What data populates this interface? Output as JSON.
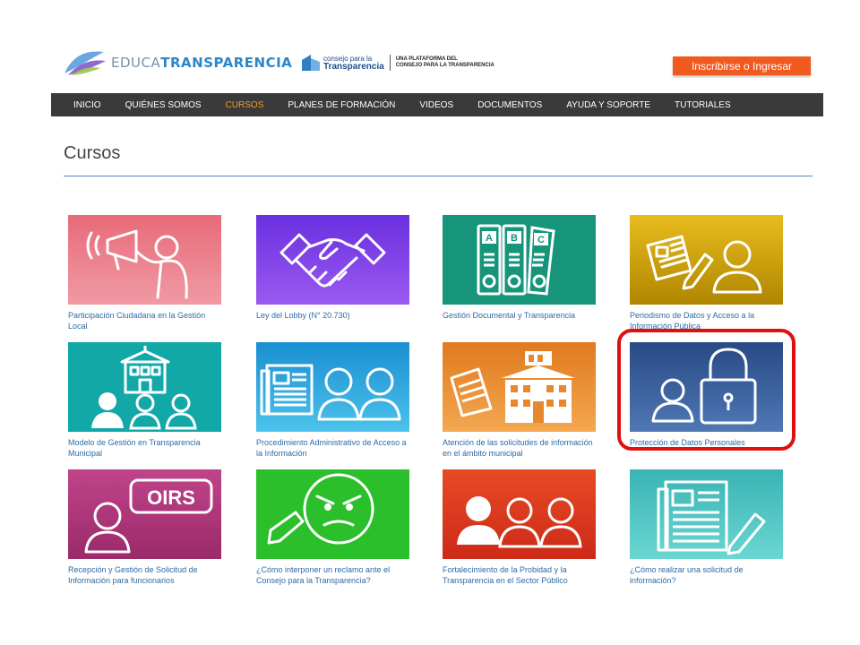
{
  "header": {
    "logo_part1": "EDUCA",
    "logo_part2": "TRANSPARENCIA",
    "cplt_small": "consejo para la",
    "cplt_big": "Transparencia",
    "cplt_tag_line1": "UNA PLATAFORMA DEL",
    "cplt_tag_line2": "CONSEJO PARA LA TRANSPARENCIA",
    "cta_label": "Inscribirse o Ingresar"
  },
  "nav": {
    "items": [
      "INICIO",
      "QUIÉNES SOMOS",
      "CURSOS",
      "PLANES DE FORMACIÓN",
      "VIDEOS",
      "DOCUMENTOS",
      "AYUDA Y SOPORTE",
      "TUTORIALES"
    ],
    "active": "CURSOS"
  },
  "page": {
    "title": "Cursos"
  },
  "courses": [
    {
      "title": "Participación Ciudadana en la Gestión Local",
      "color": "#e8707e",
      "icon": "megaphone-person-icon"
    },
    {
      "title": "Ley del Lobby (N° 20.730)",
      "color": "#7b3fe0",
      "icon": "handshake-icon"
    },
    {
      "title": "Gestión Documental y Transparencia",
      "color": "#16957a",
      "icon": "binders-icon"
    },
    {
      "title": "Periodismo de Datos y Acceso a la Información Pública",
      "color": "#d9a800",
      "icon": "newspaper-person-icon"
    },
    {
      "title": "Modelo de Gestión en Transparencia Municipal",
      "color": "#13a8a8",
      "icon": "municipality-people-icon"
    },
    {
      "title": "Procedimiento Administrativo de Acceso a la Información",
      "color": "#1e9fd8",
      "icon": "document-people-icon"
    },
    {
      "title": "Atención de las solicitudes de información en el ámbito municipal",
      "color": "#ec8a2e",
      "icon": "newspaper-building-icon"
    },
    {
      "title": "Protección de Datos Personales",
      "color": "#2f5590",
      "icon": "person-lock-icon"
    },
    {
      "title": "Recepción y Gestión de Solicitud de Información para funcionarios",
      "color": "#b33a7e",
      "icon": "oirs-person-icon",
      "badge": "OIRS"
    },
    {
      "title": "¿Cómo interponer un reclamo ante el Consejo para la Transparencia?",
      "color": "#2cbf2c",
      "icon": "angry-face-icon"
    },
    {
      "title": "Fortalecimiento de la Probidad y la Transparencia en el Sector Público",
      "color": "#e33e22",
      "icon": "people-group-icon"
    },
    {
      "title": "¿Cómo realizar una solicitud de información?",
      "color": "#4fc4c4",
      "icon": "form-pencil-icon"
    }
  ]
}
